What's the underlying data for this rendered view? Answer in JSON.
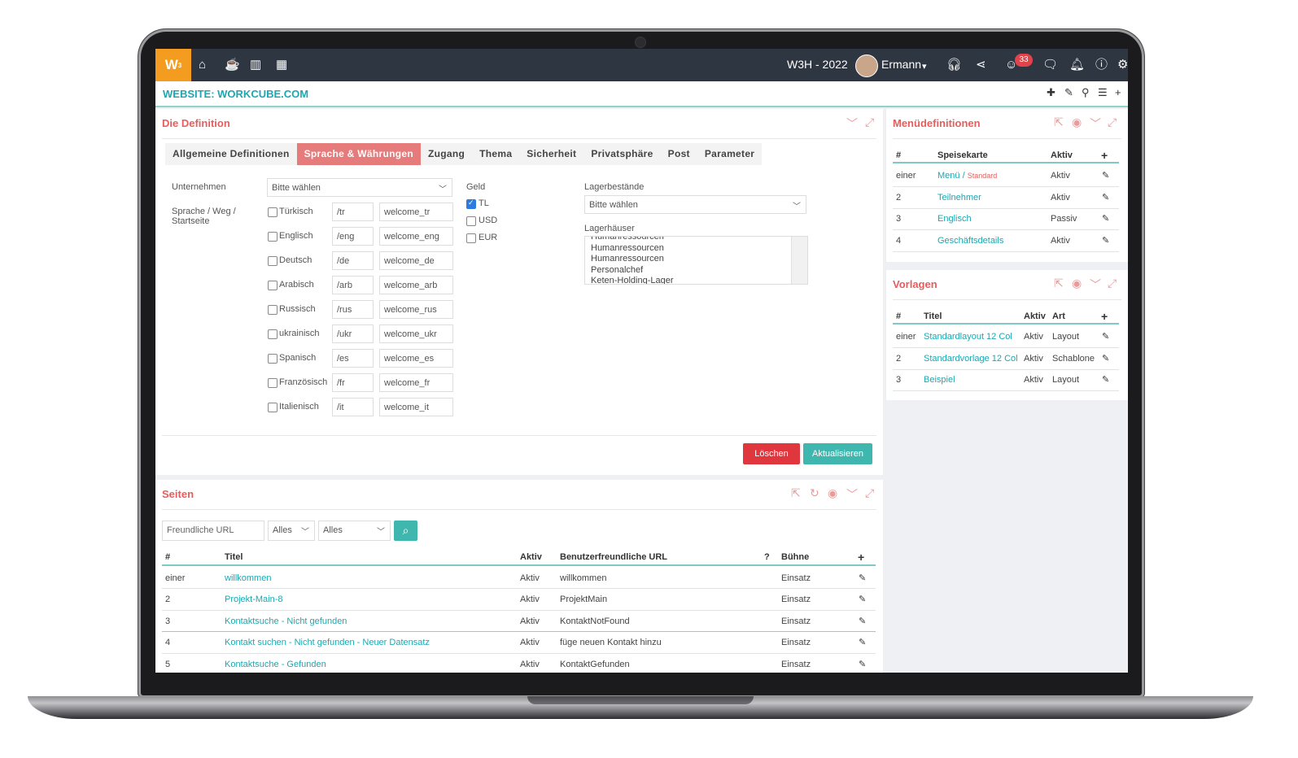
{
  "app": {
    "logo": "W",
    "logo_sup": "3",
    "period": "W3H - 2022",
    "user": "Ermann",
    "notifications": "33"
  },
  "site": {
    "title": "WEBSITE: WORKCUBE.COM"
  },
  "definition": {
    "title": "Die Definition",
    "tabs": [
      "Allgemeine Definitionen",
      "Sprache & Währungen",
      "Zugang",
      "Thema",
      "Sicherheit",
      "Privatsphäre",
      "Post",
      "Parameter"
    ],
    "company_label": "Unternehmen",
    "company_value": "Bitte wählen",
    "lang_label_1": "Sprache / Weg /",
    "lang_label_2": "Startseite",
    "languages": [
      {
        "name": "Türkisch",
        "path": "/tr",
        "page": "welcome_tr"
      },
      {
        "name": "Englisch",
        "path": "/eng",
        "page": "welcome_eng"
      },
      {
        "name": "Deutsch",
        "path": "/de",
        "page": "welcome_de"
      },
      {
        "name": "Arabisch",
        "path": "/arb",
        "page": "welcome_arb"
      },
      {
        "name": "Russisch",
        "path": "/rus",
        "page": "welcome_rus"
      },
      {
        "name": "ukrainisch",
        "path": "/ukr",
        "page": "welcome_ukr"
      },
      {
        "name": "Spanisch",
        "path": "/es",
        "page": "welcome_es"
      },
      {
        "name": "Französisch",
        "path": "/fr",
        "page": "welcome_fr"
      },
      {
        "name": "Italienisch",
        "path": "/it",
        "page": "welcome_it"
      }
    ],
    "money_label": "Geld",
    "currencies": [
      {
        "name": "TL",
        "checked": true
      },
      {
        "name": "USD",
        "checked": false
      },
      {
        "name": "EUR",
        "checked": false
      }
    ],
    "stock_label": "Lagerbestände",
    "stock_value": "Bitte wählen",
    "warehouses_label": "Lagerhäuser",
    "warehouses": [
      "Humanressourcen",
      "Humanressourcen",
      "Humanressourcen",
      "Personalchef",
      "Keten-Holding-Lager"
    ],
    "delete_label": "Löschen",
    "update_label": "Aktualisieren",
    "delete_color": "#e0373f",
    "update_color": "#3fb6ae"
  },
  "menus": {
    "title": "Menüdefinitionen",
    "headers": [
      "#",
      "Speisekarte",
      "Aktiv"
    ],
    "rows": [
      {
        "num": "einer",
        "name": "Menü",
        "sep": "/",
        "extra": "Standard",
        "status": "Aktiv"
      },
      {
        "num": "2",
        "name": "Teilnehmer",
        "sep": "",
        "extra": "",
        "status": "Aktiv"
      },
      {
        "num": "3",
        "name": "Englisch",
        "sep": "",
        "extra": "",
        "status": "Passiv"
      },
      {
        "num": "4",
        "name": "Geschäftsdetails",
        "sep": "",
        "extra": "",
        "status": "Aktiv"
      }
    ]
  },
  "templates": {
    "title": "Vorlagen",
    "headers": [
      "#",
      "Titel",
      "Aktiv",
      "Art"
    ],
    "rows": [
      {
        "num": "einer",
        "name": "Standardlayout 12 Col",
        "status": "Aktiv",
        "type": "Layout"
      },
      {
        "num": "2",
        "name": "Standardvorlage 12 Col",
        "status": "Aktiv",
        "type": "Schablone"
      },
      {
        "num": "3",
        "name": "Beispiel",
        "status": "Aktiv",
        "type": "Layout"
      }
    ]
  },
  "pages": {
    "title": "Seiten",
    "filter_placeholder": "Freundliche URL",
    "filter_1": "Alles",
    "filter_2": "Alles",
    "headers": [
      "#",
      "Titel",
      "Aktiv",
      "Benutzerfreundliche URL",
      "?",
      "Bühne"
    ],
    "rows": [
      {
        "num": "einer",
        "title": "willkommen",
        "status": "Aktiv",
        "url": "willkommen",
        "stage": "Einsatz"
      },
      {
        "num": "2",
        "title": "Projekt-Main-8",
        "status": "Aktiv",
        "url": "ProjektMain",
        "stage": "Einsatz"
      },
      {
        "num": "3",
        "title": "Kontaktsuche - Nicht gefunden",
        "status": "Aktiv",
        "url": "KontaktNotFound",
        "stage": "Einsatz"
      },
      {
        "num": "4",
        "title": "Kontakt suchen - Nicht gefunden - Neuer Datensatz",
        "status": "Aktiv",
        "url": "füge neuen Kontakt hinzu",
        "stage": "Einsatz"
      },
      {
        "num": "5",
        "title": "Kontaktsuche - Gefunden",
        "status": "Aktiv",
        "url": "KontaktGefunden",
        "stage": "Einsatz"
      }
    ]
  },
  "colors": {
    "accent": "#1ba8b0",
    "title_red": "#e55d5d",
    "topbar": "#2e3641",
    "logo": "#f39c1f"
  }
}
